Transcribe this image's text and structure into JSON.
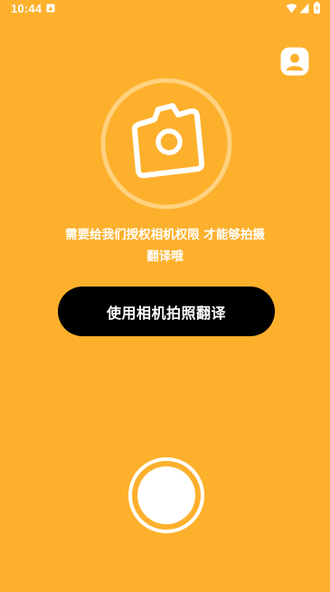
{
  "status_bar": {
    "time": "10:44",
    "icons": [
      "notification-icon",
      "wifi-icon",
      "signal-icon",
      "battery-icon"
    ]
  },
  "header": {
    "profile_icon": "profile-icon"
  },
  "camera_prompt": {
    "icon": "camera-icon",
    "message_line1": "需要给我们授权相机权限 才能够拍摄",
    "message_line2": "翻译哦"
  },
  "actions": {
    "translate_button_label": "使用相机拍照翻译",
    "shutter_icon": "shutter-button"
  },
  "colors": {
    "background": "#FDB02C",
    "button": "#000000",
    "text": "#FFFFFF",
    "ring": "#FFD27F"
  }
}
